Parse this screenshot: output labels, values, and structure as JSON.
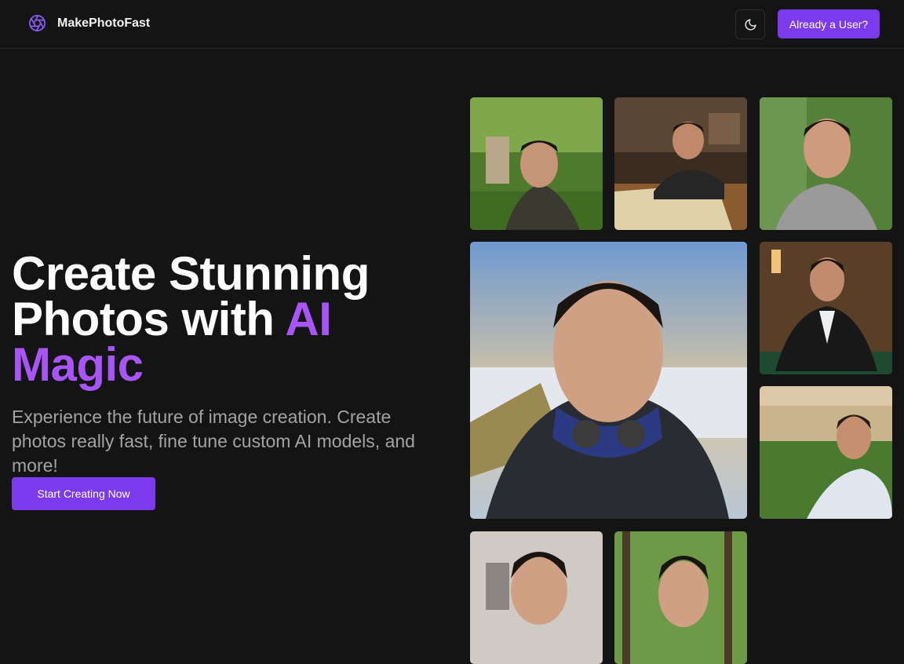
{
  "header": {
    "brand_name": "MakePhotoFast",
    "logo_icon": "aperture-icon",
    "theme_toggle_icon": "moon-icon",
    "login_button_label": "Already a User?"
  },
  "hero": {
    "title_line1": "Create Stunning",
    "title_line2_plain": "Photos with ",
    "title_line2_accent": "AI",
    "title_line3_accent": "Magic",
    "subtitle": "Experience the future of image creation. Create photos really fast, fine tune custom AI models, and more!",
    "cta_label": "Start Creating Now"
  },
  "gallery": {
    "photos": [
      "garden-portrait",
      "map-table-portrait",
      "smiling-outdoor-portrait",
      "mountain-selfie",
      "casino-tuxedo-portrait",
      "lakeside-portrait",
      "indoor-portrait",
      "forest-portrait"
    ]
  },
  "colors": {
    "accent": "#7c3aed",
    "accent_text": "#a855f7",
    "background": "#141414",
    "muted_text": "#a3a3a3"
  }
}
